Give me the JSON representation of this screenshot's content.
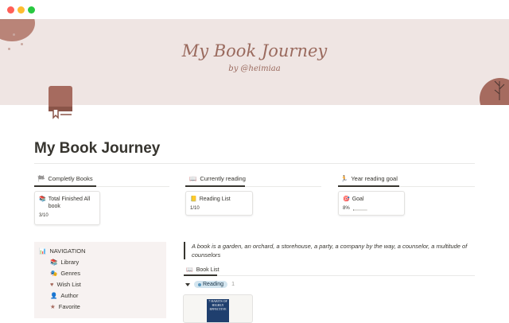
{
  "window": {
    "controls": [
      "close",
      "minimize",
      "maximize"
    ]
  },
  "cover": {
    "title": "My Book Journey",
    "subtitle": "by @heimiaa"
  },
  "page": {
    "title": "My Book Journey",
    "icon": "book-icon"
  },
  "columns": [
    {
      "heading": "Completly Books",
      "icon": "checkered-flag-icon",
      "card": {
        "title": "Total Finished  All book",
        "icon": "books-icon",
        "value": "3/10"
      }
    },
    {
      "heading": "Currently reading",
      "icon": "open-book-icon",
      "card": {
        "title": "Reading List",
        "icon": "notebook-icon",
        "value": "1/10"
      }
    },
    {
      "heading": "Year reading goal",
      "icon": "person-running-icon",
      "card": {
        "title": "Goal",
        "icon": "target-icon",
        "value": "8%",
        "progress": 0.08
      }
    }
  ],
  "navigation": {
    "heading": "NAVIGATION",
    "icon": "bar-chart-icon",
    "items": [
      {
        "label": "Library",
        "icon": "books-icon"
      },
      {
        "label": "Genres",
        "icon": "masks-icon"
      },
      {
        "label": "Wish List",
        "icon": "heart-icon"
      },
      {
        "label": "Author",
        "icon": "person-icon"
      },
      {
        "label": "Favorite",
        "icon": "star-icon"
      }
    ]
  },
  "quote": "A book is a garden, an orchard, a storehouse, a party, a company by the way, a counselor, a multitude of counselors",
  "book_list": {
    "heading": "Book List",
    "icon": "open-book-icon",
    "group": {
      "label": "Reading",
      "count": "1"
    },
    "gallery": [
      {
        "cover_text": "7 HABITS OF HIGHLY EFFECTIVE"
      }
    ]
  },
  "colors": {
    "cover_bg": "#efe5e3",
    "accent_brown": "#a66b5f",
    "nav_bg": "#f7f2f1",
    "pill_bg": "#d3e5ef"
  }
}
